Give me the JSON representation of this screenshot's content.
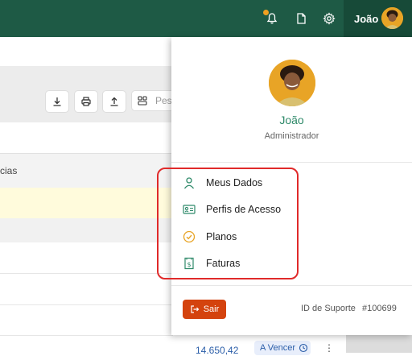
{
  "header": {
    "user_name": "João",
    "icons": [
      "bell-icon",
      "document-icon",
      "gear-icon"
    ],
    "notification_dot_color": "#f0a020",
    "bar_color": "#1e5a45"
  },
  "background": {
    "search_placeholder": "Pes",
    "column_header_partial": "cias",
    "amount": "14.650,42",
    "status_badge": "A Vencer"
  },
  "dropdown": {
    "name": "João",
    "role": "Administrador",
    "menu": [
      {
        "label": "Meus Dados",
        "icon": "user-icon"
      },
      {
        "label": "Perfis de Acesso",
        "icon": "id-card-icon"
      },
      {
        "label": "Planos",
        "icon": "check-circle-icon"
      },
      {
        "label": "Faturas",
        "icon": "receipt-icon"
      }
    ],
    "logout_label": "Sair",
    "support_label": "ID de Suporte",
    "support_id": "#100699",
    "accent_color": "#2f8a6a",
    "logout_color": "#d4430e",
    "highlight_color": "#e02a2a"
  }
}
